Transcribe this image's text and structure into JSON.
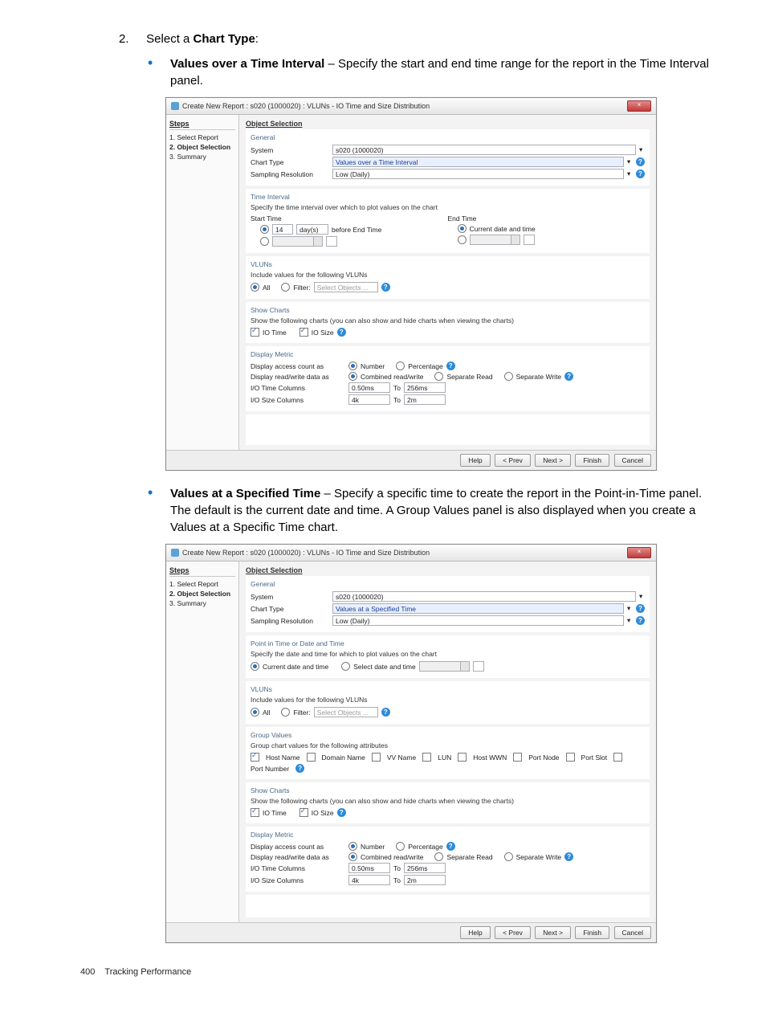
{
  "step": {
    "num": "2.",
    "text_a": "Select a ",
    "text_b": "Chart Type",
    "text_c": ":"
  },
  "bullet1": {
    "title": "Values over a Time Interval",
    "rest": " – Specify the start and end time range for the report in the Time Interval panel."
  },
  "bullet2": {
    "title": "Values at a Specified Time",
    "rest": " – Specify a specific time to create the report in the Point-in-Time panel. The default is the current date and time. A Group Values panel is also displayed when you create a Values at a Specific Time chart."
  },
  "dialog": {
    "title": "Create New Report : s020 (1000020) : VLUNs - IO Time and Size Distribution",
    "close": "×",
    "steps_header": "Steps",
    "steps": [
      "1. Select Report",
      "2. Object Selection",
      "3. Summary"
    ],
    "section": "Object Selection",
    "general": {
      "hdr": "General",
      "system_label": "System",
      "system_value": "s020 (1000020)",
      "charttype_label": "Chart Type",
      "charttype_value_interval": "Values over a Time Interval",
      "charttype_value_specified": "Values at a Specified Time",
      "sampling_label": "Sampling Resolution",
      "sampling_value": "Low (Daily)"
    },
    "time": {
      "hdr": "Time Interval",
      "desc": "Specify the time interval over which to plot values on the chart",
      "start": "Start Time",
      "end": "End Time",
      "rel_value": "14",
      "rel_unit": "day(s)",
      "rel_suffix": "before End Time",
      "current": "Current date and time"
    },
    "pit": {
      "hdr": "Point in Time or Date and Time",
      "desc": "Specify the date and time for which to plot values on the chart",
      "opt1": "Current date and time",
      "opt2": "Select date and time"
    },
    "vluns": {
      "hdr": "VLUNs",
      "desc": "Include values for the following VLUNs",
      "all": "All",
      "filter": "Filter:",
      "placeholder": "Select Objects ..."
    },
    "group": {
      "hdr": "Group Values",
      "desc": "Group chart values for the following attributes",
      "opts": [
        "Host Name",
        "Domain Name",
        "VV Name",
        "LUN",
        "Host WWN",
        "Port Node",
        "Port Slot",
        "Port Number"
      ]
    },
    "show": {
      "hdr": "Show Charts",
      "desc": "Show the following charts (you can also show and hide charts when viewing the charts)",
      "opt1": "IO Time",
      "opt2": "IO Size"
    },
    "disp": {
      "hdr": "Display Metric",
      "access_label": "Display access count as",
      "number": "Number",
      "percentage": "Percentage",
      "rw_label": "Display read/write data as",
      "combined": "Combined read/write",
      "sep_read": "Separate Read",
      "sep_write": "Separate Write",
      "iotime_label": "I/O Time Columns",
      "iotime_from": "0.50ms",
      "to": "To",
      "iotime_to": "256ms",
      "iosize_label": "I/O Size Columns",
      "iosize_from": "4k",
      "iosize_to": "2m"
    },
    "buttons": {
      "help": "Help",
      "prev": "< Prev",
      "next": "Next >",
      "finish": "Finish",
      "cancel": "Cancel"
    }
  },
  "footer": {
    "page": "400",
    "section": "Tracking Performance"
  }
}
